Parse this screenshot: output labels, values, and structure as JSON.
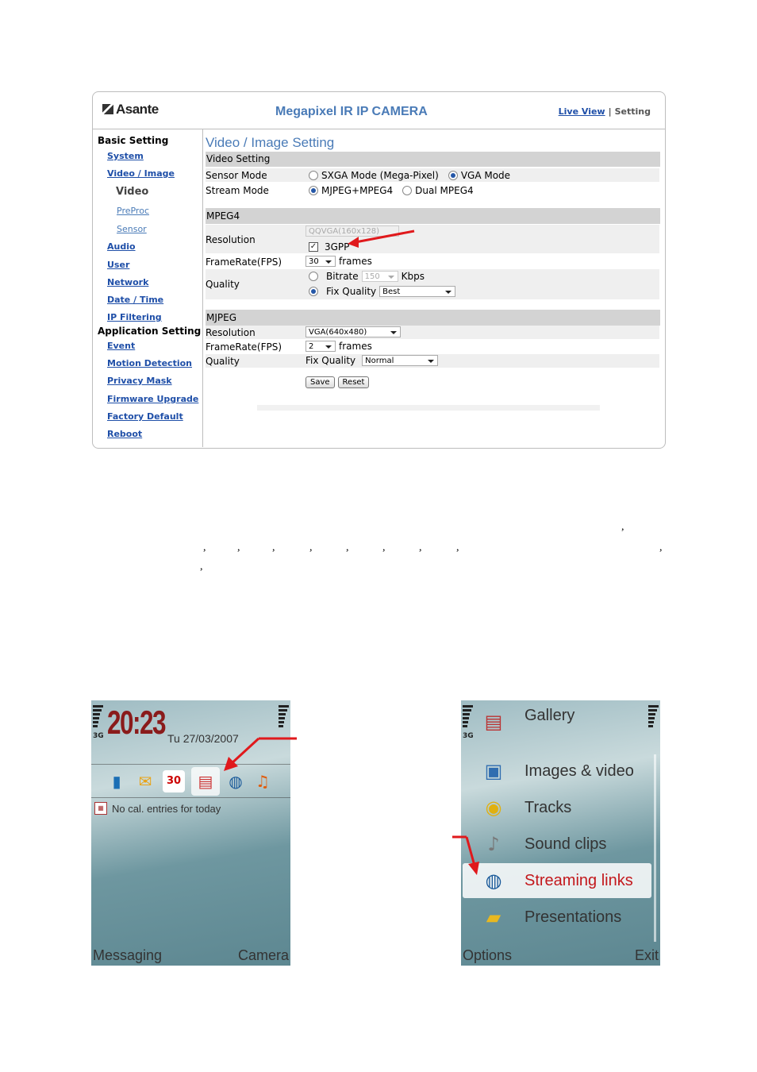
{
  "camera": {
    "brand": "Asante",
    "title": "Megapixel IR IP CAMERA",
    "header_links": {
      "live_view": "Live View",
      "separator": "|",
      "setting": "Setting"
    },
    "sidebar": {
      "basic_heading": "Basic Setting",
      "system": "System",
      "video_image": "Video / Image",
      "current": "Video",
      "preproc": "PreProc",
      "sensor": "Sensor",
      "audio": "Audio",
      "user": "User",
      "network": "Network",
      "date_time": "Date / Time",
      "ip_filtering": "IP Filtering",
      "app_heading": "Application Setting",
      "event": "Event",
      "motion_detection": "Motion Detection",
      "privacy_mask": "Privacy Mask",
      "firmware_upgrade": "Firmware Upgrade",
      "factory_default": "Factory Default",
      "reboot": "Reboot"
    },
    "page_title": "Video / Image Setting",
    "video_setting": {
      "heading": "Video Setting",
      "sensor_mode_label": "Sensor Mode",
      "sensor_opt1": "SXGA Mode (Mega-Pixel)",
      "sensor_opt2": "VGA Mode",
      "stream_mode_label": "Stream Mode",
      "stream_opt1": "MJPEG+MPEG4",
      "stream_opt2": "Dual MPEG4"
    },
    "mpeg4": {
      "heading": "MPEG4",
      "resolution_label": "Resolution",
      "resolution_value": "QQVGA(160x128)",
      "gpp_label": "3GPP",
      "framerate_label": "FrameRate(FPS)",
      "framerate_value": "30",
      "frames_unit": "frames",
      "quality_label": "Quality",
      "bitrate_label": "Bitrate",
      "bitrate_value": "150",
      "kbps_unit": "Kbps",
      "fix_quality_label": "Fix Quality",
      "fix_quality_value": "Best"
    },
    "mjpeg": {
      "heading": "MJPEG",
      "resolution_label": "Resolution",
      "resolution_value": "VGA(640x480)",
      "framerate_label": "FrameRate(FPS)",
      "framerate_value": "2",
      "frames_unit": "frames",
      "quality_label": "Quality",
      "fix_quality_label": "Fix Quality",
      "fix_quality_value": "Normal"
    },
    "buttons": {
      "save": "Save",
      "reset": "Reset"
    }
  },
  "punctuation": ",",
  "phone_home": {
    "time": "20:23",
    "date": "Tu 27/03/2007",
    "network": "3G",
    "cal_icon": "30",
    "cal_note": "No cal. entries for today",
    "left_softkey": "Messaging",
    "right_softkey": "Camera",
    "shortcut_icons": [
      "contacts-icon",
      "messaging-icon",
      "calendar-icon",
      "gallery-icon",
      "web-icon",
      "music-icon"
    ]
  },
  "phone_gallery": {
    "network": "3G",
    "items": [
      "Gallery",
      "Images & video",
      "Tracks",
      "Sound clips",
      "Streaming links",
      "Presentations"
    ],
    "selected_item": "Streaming links",
    "left_softkey": "Options",
    "right_softkey": "Exit"
  },
  "colors": {
    "link": "#1f4fa8",
    "title": "#4a7bb7",
    "band": "#d3d3d3",
    "arrow": "#e0191c",
    "clock": "#8a1b1b",
    "highlight_text": "#c3181c"
  }
}
